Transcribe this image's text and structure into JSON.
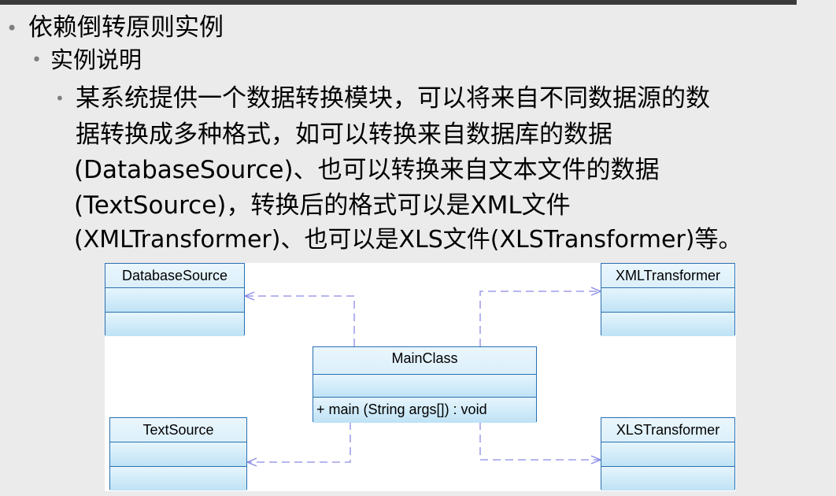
{
  "slide": {
    "level1": {
      "text": "依赖倒转原则实例"
    },
    "level2": {
      "text": "实例说明"
    },
    "level3": {
      "lines": [
        "某系统提供一个数据转换模块，可以将来自不同数据源的数",
        "据转换成多种格式，如可以转换来自数据库的数据",
        "(DatabaseSource)、也可以转换来自文本文件的数据",
        "(TextSource)，转换后的格式可以是XML文件",
        "(XMLTransformer)、也可以是XLS文件(XLSTransformer)等。"
      ]
    }
  },
  "diagram": {
    "classes": {
      "database_source": {
        "name": "DatabaseSource"
      },
      "text_source": {
        "name": "TextSource"
      },
      "main_class": {
        "name": "MainClass",
        "operation": "+ main (String args[]) : void"
      },
      "xml_transformer": {
        "name": "XMLTransformer"
      },
      "xls_transformer": {
        "name": "XLSTransformer"
      }
    },
    "dependencies": [
      {
        "from": "MainClass",
        "to": "DatabaseSource"
      },
      {
        "from": "MainClass",
        "to": "TextSource"
      },
      {
        "from": "MainClass",
        "to": "XMLTransformer"
      },
      {
        "from": "MainClass",
        "to": "XLSTransformer"
      }
    ]
  },
  "colors": {
    "bullet": "#7f7f7f",
    "class_border": "#2a6fb0",
    "class_fill_top": "#eaf6fd",
    "class_fill_bottom": "#bfe3f6",
    "dependency_line": "#8a8ae6"
  }
}
